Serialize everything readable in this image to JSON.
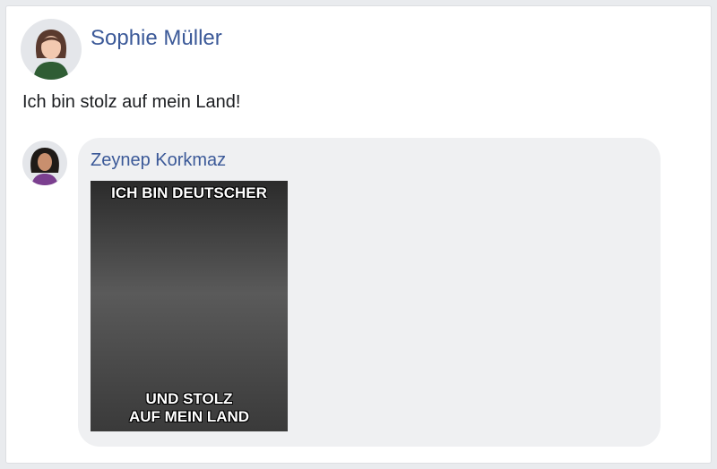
{
  "post": {
    "author": "Sophie Müller",
    "text": "Ich bin stolz auf mein Land!"
  },
  "reply": {
    "author": "Zeynep Korkmaz",
    "image": {
      "caption_top": "ICH BIN DEUTSCHER",
      "caption_bottom_1": "UND STOLZ",
      "caption_bottom_2": "AUF MEIN LAND"
    }
  },
  "colors": {
    "link": "#3b5998",
    "bubble": "#eff0f2",
    "page_bg": "#e9ebee"
  },
  "icons": {
    "post_avatar": "avatar-woman-icon",
    "reply_avatar": "avatar-woman-icon"
  }
}
